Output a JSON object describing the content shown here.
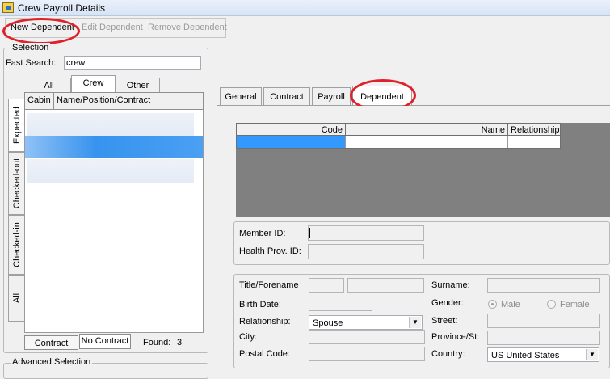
{
  "window": {
    "title": "Crew Payroll Details",
    "icon": "app-window-icon"
  },
  "toolbar": {
    "new_dependent": "New Dependent",
    "edit_dependent": "Edit Dependent",
    "remove_dependent": "Remove Dependent"
  },
  "selection": {
    "group_label": "Selection",
    "fast_search_label": "Fast Search:",
    "fast_search_value": "crew",
    "tabs": [
      "All",
      "Crew",
      "Other"
    ],
    "active_tab": "Crew",
    "columns": [
      "Cabin",
      "Name/Position/Contract"
    ],
    "side_tabs": [
      "Expected",
      "Checked-out",
      "Checked-in",
      "All"
    ],
    "contract_button": "Contract",
    "no_contract_button": "No Contract",
    "found_label": "Found:",
    "found_count": "3"
  },
  "advanced_selection": {
    "label": "Advanced Selection"
  },
  "detail_tabs": [
    "General",
    "Contract",
    "Payroll",
    "Dependent"
  ],
  "active_detail_tab": "Dependent",
  "dependent_grid": {
    "columns": [
      "Code",
      "Name",
      "Relationship"
    ]
  },
  "member": {
    "member_id_label": "Member ID:",
    "member_id_value": "",
    "health_prov_label": "Health Prov. ID:",
    "health_prov_value": ""
  },
  "dependent_form": {
    "title_forename_label": "Title/Forename",
    "birth_date_label": "Birth Date:",
    "relationship_label": "Relationship:",
    "relationship_value": "Spouse",
    "city_label": "City:",
    "postal_code_label": "Postal Code:",
    "surname_label": "Surname:",
    "gender_label": "Gender:",
    "gender_male": "Male",
    "gender_female": "Female",
    "gender_selected": "Male",
    "street_label": "Street:",
    "province_label": "Province/St:",
    "country_label": "Country:",
    "country_value": "US United States"
  },
  "colors": {
    "annotation": "#e0202a",
    "selected_row": "#3793ee",
    "grid_background": "#808080"
  }
}
